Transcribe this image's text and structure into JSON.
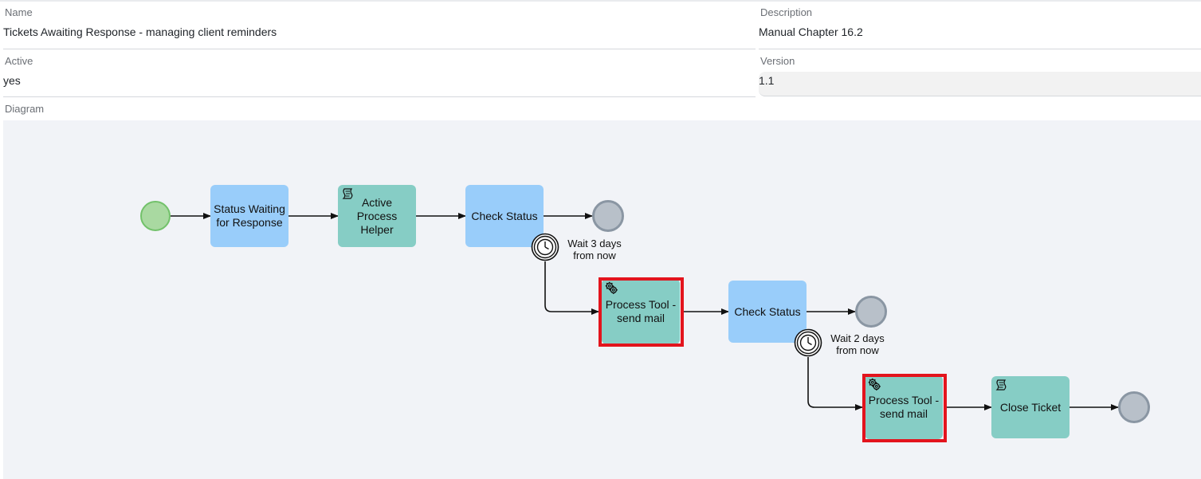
{
  "form": {
    "name_label": "Name",
    "name_value": "Tickets Awaiting Response - managing client reminders",
    "description_label": "Description",
    "description_value": "Manual Chapter 16.2",
    "active_label": "Active",
    "active_value": "yes",
    "version_label": "Version",
    "version_value": "1.1",
    "diagram_label": "Diagram"
  },
  "diagram": {
    "tasks": {
      "status_waiting": "Status Waiting for Response",
      "active_helper": "Active Process Helper",
      "check_status_1": "Check Status",
      "send_mail_1": "Process Tool - send mail",
      "check_status_2": "Check Status",
      "send_mail_2": "Process Tool - send mail",
      "close_ticket": "Close Ticket"
    },
    "timers": {
      "wait_1": "Wait 3 days from now",
      "wait_2": "Wait 2 days from now"
    },
    "colors": {
      "user_task": "#99cdfa",
      "script_task": "#86cdc5",
      "highlight": "#e3141d",
      "start_event": "#a9d9a1",
      "end_event": "#b8c0c9",
      "canvas": "#f1f3f7"
    },
    "icons": {
      "script": "script-icon",
      "service": "gear-icon",
      "timer": "clock-icon"
    }
  }
}
